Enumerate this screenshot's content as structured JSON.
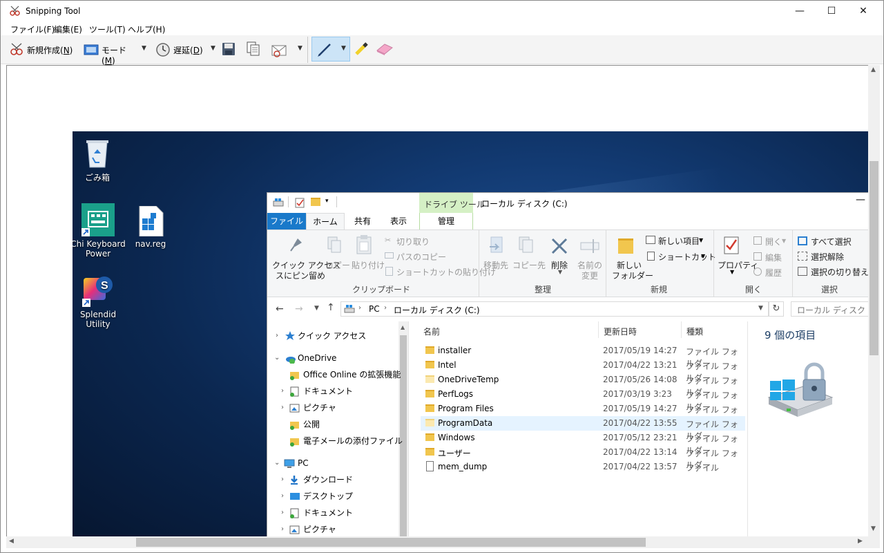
{
  "window": {
    "title": "Snipping Tool",
    "minimize": "—",
    "maximize": "☐",
    "close": "✕"
  },
  "menu": [
    "ファイル(F)",
    "編集(E)",
    "ツール(T)",
    "ヘルプ(H)"
  ],
  "toolbar": {
    "new_label": "新規作成(",
    "new_key": "N",
    "new_end": ")",
    "mode_label": "モード(",
    "mode_key": "M",
    "mode_end": ")",
    "delay_label": "遅延(",
    "delay_key": "D",
    "delay_end": ")"
  },
  "desktop": {
    "icons": [
      {
        "label": "ごみ箱"
      },
      {
        "label": "Chi Keyboard Power"
      },
      {
        "label": "nav.reg"
      },
      {
        "label": "Splendid Utility"
      }
    ]
  },
  "explorer": {
    "qat_title": "ローカル ディスク (C:)",
    "drive_tools": "ドライブ ツール",
    "tabs": {
      "file": "ファイル",
      "home": "ホーム",
      "share": "共有",
      "view": "表示",
      "manage": "管理"
    },
    "ribbon": {
      "pin": "クイック アクセス",
      "pin2": "スにピン留め",
      "copy": "コピー",
      "paste": "貼り付け",
      "cut": "切り取り",
      "copy_path": "パスのコピー",
      "paste_shortcut": "ショートカットの貼り付け",
      "clipboard": "クリップボード",
      "move_to": "移動先",
      "copy_to": "コピー先",
      "delete": "削除",
      "rename": "名前の",
      "rename2": "変更",
      "organize": "整理",
      "new_folder": "新しい",
      "new_folder2": "フォルダー",
      "new_item": "新しい項目",
      "easy_access": "ショートカット",
      "new_group": "新規",
      "properties": "プロパティ",
      "open": "開く",
      "edit": "編集",
      "history": "履歴",
      "open_group": "開く",
      "select_all": "すべて選択",
      "select_none": "選択解除",
      "invert": "選択の切り替え",
      "select_group": "選択"
    },
    "address": {
      "pc": "PC",
      "disk": "ローカル ディスク (C:)",
      "search_placeholder": "ローカル ディスク (C:)の"
    },
    "nav": [
      {
        "label": "クイック アクセス"
      },
      {
        "label": "OneDrive"
      },
      {
        "label": "Office Online の拡張機能"
      },
      {
        "label": "ドキュメント"
      },
      {
        "label": "ピクチャ"
      },
      {
        "label": "公開"
      },
      {
        "label": "電子メールの添付ファイル"
      },
      {
        "label": "PC"
      },
      {
        "label": "ダウンロード"
      },
      {
        "label": "デスクトップ"
      },
      {
        "label": "ドキュメント"
      },
      {
        "label": "ピクチャ"
      }
    ],
    "columns": {
      "name": "名前",
      "date": "更新日時",
      "type": "種類"
    },
    "files": [
      {
        "name": "installer",
        "date": "2017/05/19 14:27",
        "type": "ファイル フォルダー"
      },
      {
        "name": "Intel",
        "date": "2017/04/22 13:21",
        "type": "ファイル フォルダー"
      },
      {
        "name": "OneDriveTemp",
        "date": "2017/05/26 14:08",
        "type": "ファイル フォルダー"
      },
      {
        "name": "PerfLogs",
        "date": "2017/03/19 3:23",
        "type": "ファイル フォルダー"
      },
      {
        "name": "Program Files",
        "date": "2017/05/19 14:27",
        "type": "ファイル フォルダー"
      },
      {
        "name": "ProgramData",
        "date": "2017/04/22 13:55",
        "type": "ファイル フォルダー"
      },
      {
        "name": "Windows",
        "date": "2017/05/12 23:21",
        "type": "ファイル フォルダー"
      },
      {
        "name": "ユーザー",
        "date": "2017/04/22 13:14",
        "type": "ファイル フォルダー"
      },
      {
        "name": "mem_dump",
        "date": "2017/04/22 13:57",
        "type": "ファイル"
      }
    ],
    "item_count": "9 個の項目"
  }
}
